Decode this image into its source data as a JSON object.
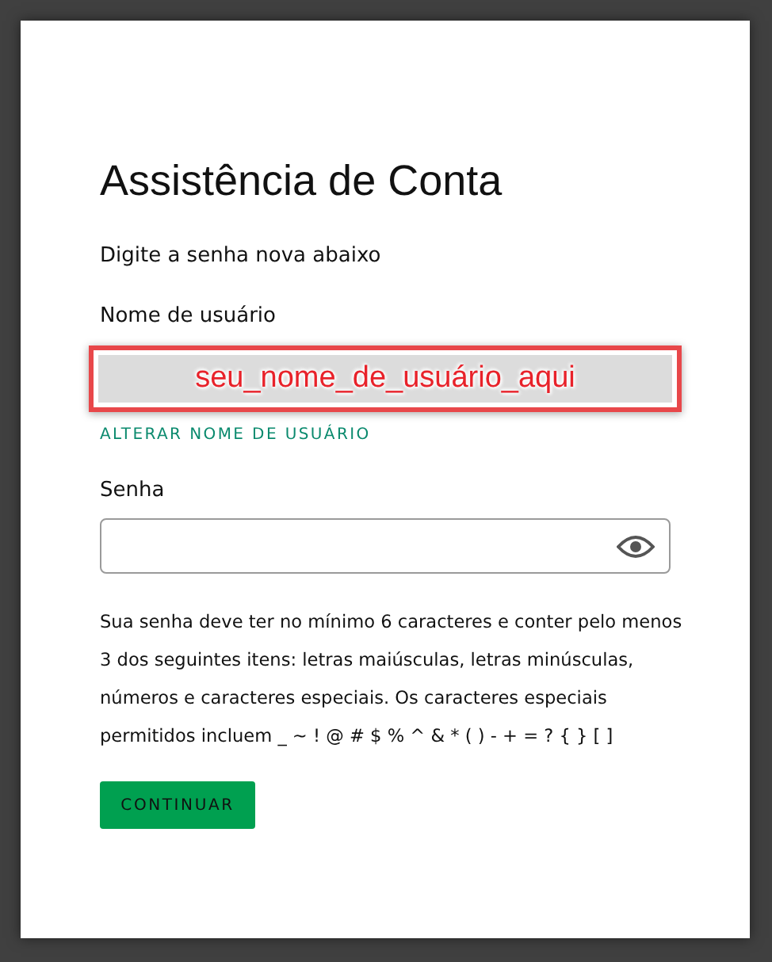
{
  "title": "Assistência de Conta",
  "subtitle": "Digite a senha nova abaixo",
  "username": {
    "label": "Nome de usuário",
    "value": "seu_nome_de_usuário_aqui",
    "link": "ALTERAR NOME DE USUÁRIO"
  },
  "password": {
    "label": "Senha"
  },
  "hint": "Sua senha deve ter no mínimo 6 caracteres e conter pelo menos 3 dos seguintes itens: letras maiúsculas, letras minúsculas, números e caracteres especiais. Os caracteres especiais permitidos incluem _ ~ ! @ # $ % ^ & * ( ) - + = ? { } [ ]",
  "button": "CONTINUAR"
}
